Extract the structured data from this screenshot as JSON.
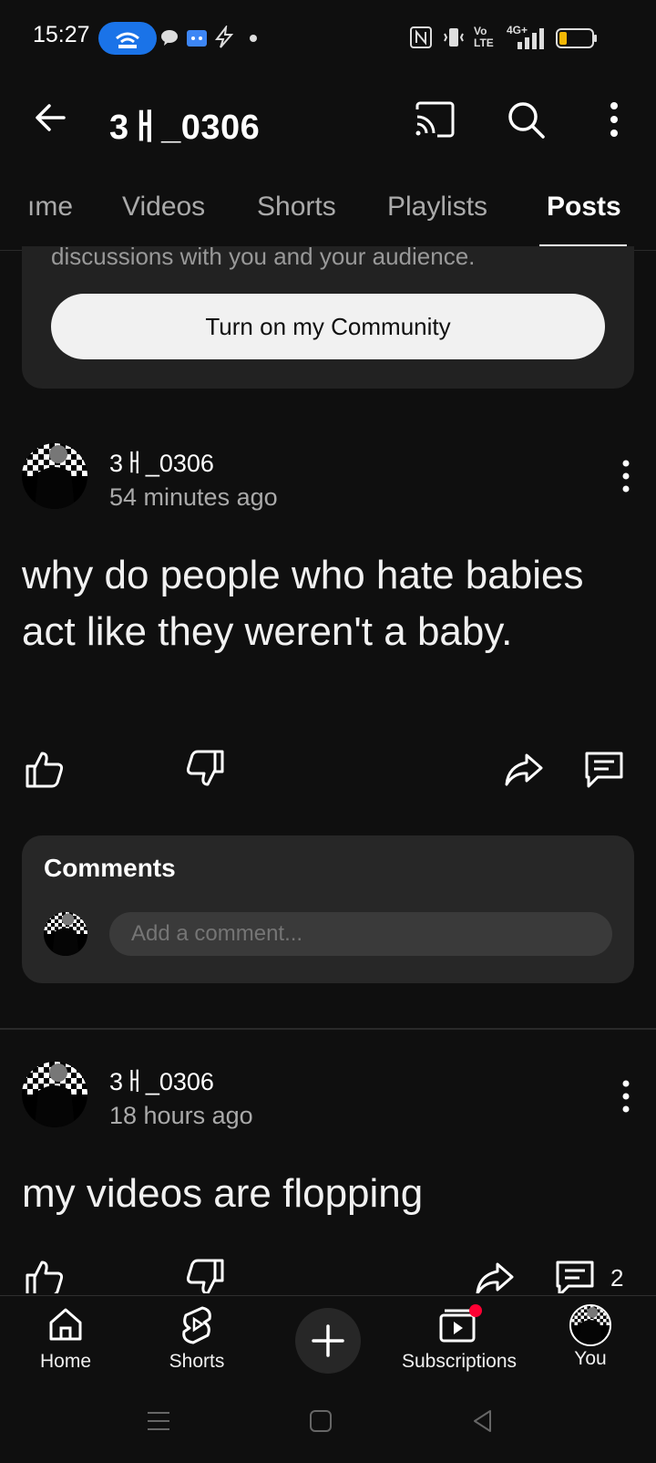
{
  "status_bar": {
    "time": "15:27",
    "network": "4G+",
    "volte": "Vo LTE",
    "icons": [
      "hotspot-icon",
      "chat-bubble-icon",
      "android-icon",
      "bolt-icon",
      "dot-icon",
      "nfc-icon",
      "vibrate-icon",
      "volte-icon",
      "signal-icon",
      "battery-icon"
    ]
  },
  "header": {
    "channel_name": "3ㅐ_0306",
    "icons": [
      "back-arrow-icon",
      "cast-icon",
      "search-icon",
      "more-vert-icon"
    ]
  },
  "tabs": [
    {
      "label": "Home",
      "visible_label": "ıme",
      "active": false
    },
    {
      "label": "Videos",
      "active": false
    },
    {
      "label": "Shorts",
      "active": false
    },
    {
      "label": "Playlists",
      "active": false
    },
    {
      "label": "Posts",
      "active": true
    }
  ],
  "community_card": {
    "partial_text": "discussions with you and your audience.",
    "button_label": "Turn on my Community"
  },
  "posts": [
    {
      "author": "3ㅐ_0306",
      "time_ago": "54 minutes ago",
      "text": "why do people who hate babies act like they weren't a baby.",
      "comments_panel": {
        "title": "Comments",
        "placeholder": "Add a comment..."
      }
    },
    {
      "author": "3ㅐ_0306",
      "time_ago": "18 hours ago",
      "text": "my videos are flopping",
      "comment_count": "2"
    }
  ],
  "bottom_nav": [
    {
      "label": "Home",
      "icon": "home-icon"
    },
    {
      "label": "Shorts",
      "icon": "shorts-icon"
    },
    {
      "label": "",
      "icon": "create-plus-icon"
    },
    {
      "label": "Subscriptions",
      "icon": "subscriptions-icon",
      "badge": true
    },
    {
      "label": "You",
      "icon": "avatar"
    }
  ],
  "colors": {
    "background": "#0f0f0f",
    "card": "#272727",
    "accent_blue": "#1a73e8",
    "notification_red": "#ff0033",
    "battery_yellow": "#f2b705"
  }
}
